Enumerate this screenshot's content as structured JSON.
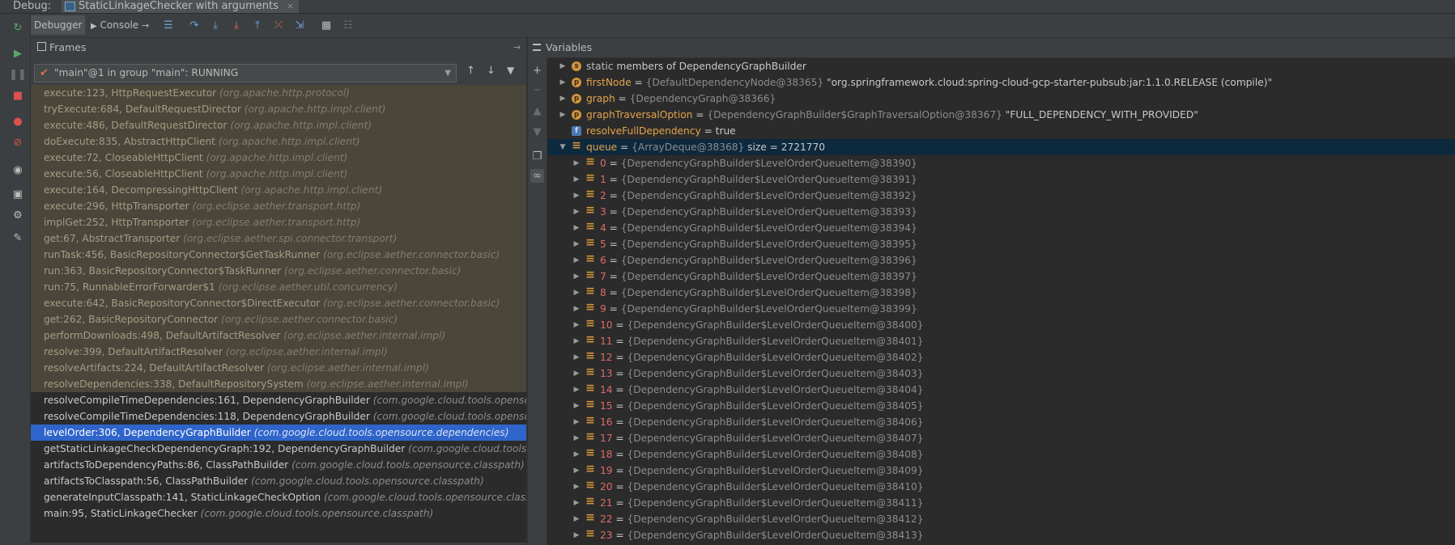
{
  "topbar": {
    "label": "Debug:",
    "tab_title": "StaticLinkageChecker with arguments",
    "close": "×"
  },
  "toolbar": {
    "debugger_tab": "Debugger",
    "console_tab": "Console",
    "console_arrow": "→"
  },
  "frames": {
    "title": "Frames",
    "pin": "→",
    "thread_selector": "\"main\"@1 in group \"main\": RUNNING",
    "items": [
      {
        "method": "execute:123, HttpRequestExecutor",
        "pkg": "(org.apache.http.protocol)",
        "kind": "lib"
      },
      {
        "method": "tryExecute:684, DefaultRequestDirector",
        "pkg": "(org.apache.http.impl.client)",
        "kind": "lib"
      },
      {
        "method": "execute:486, DefaultRequestDirector",
        "pkg": "(org.apache.http.impl.client)",
        "kind": "lib"
      },
      {
        "method": "doExecute:835, AbstractHttpClient",
        "pkg": "(org.apache.http.impl.client)",
        "kind": "lib"
      },
      {
        "method": "execute:72, CloseableHttpClient",
        "pkg": "(org.apache.http.impl.client)",
        "kind": "lib"
      },
      {
        "method": "execute:56, CloseableHttpClient",
        "pkg": "(org.apache.http.impl.client)",
        "kind": "lib"
      },
      {
        "method": "execute:164, DecompressingHttpClient",
        "pkg": "(org.apache.http.impl.client)",
        "kind": "lib"
      },
      {
        "method": "execute:296, HttpTransporter",
        "pkg": "(org.eclipse.aether.transport.http)",
        "kind": "lib"
      },
      {
        "method": "implGet:252, HttpTransporter",
        "pkg": "(org.eclipse.aether.transport.http)",
        "kind": "lib"
      },
      {
        "method": "get:67, AbstractTransporter",
        "pkg": "(org.eclipse.aether.spi.connector.transport)",
        "kind": "lib"
      },
      {
        "method": "runTask:456, BasicRepositoryConnector$GetTaskRunner",
        "pkg": "(org.eclipse.aether.connector.basic)",
        "kind": "lib"
      },
      {
        "method": "run:363, BasicRepositoryConnector$TaskRunner",
        "pkg": "(org.eclipse.aether.connector.basic)",
        "kind": "lib"
      },
      {
        "method": "run:75, RunnableErrorForwarder$1",
        "pkg": "(org.eclipse.aether.util.concurrency)",
        "kind": "lib"
      },
      {
        "method": "execute:642, BasicRepositoryConnector$DirectExecutor",
        "pkg": "(org.eclipse.aether.connector.basic)",
        "kind": "lib"
      },
      {
        "method": "get:262, BasicRepositoryConnector",
        "pkg": "(org.eclipse.aether.connector.basic)",
        "kind": "lib"
      },
      {
        "method": "performDownloads:498, DefaultArtifactResolver",
        "pkg": "(org.eclipse.aether.internal.impl)",
        "kind": "lib"
      },
      {
        "method": "resolve:399, DefaultArtifactResolver",
        "pkg": "(org.eclipse.aether.internal.impl)",
        "kind": "lib"
      },
      {
        "method": "resolveArtifacts:224, DefaultArtifactResolver",
        "pkg": "(org.eclipse.aether.internal.impl)",
        "kind": "lib"
      },
      {
        "method": "resolveDependencies:338, DefaultRepositorySystem",
        "pkg": "(org.eclipse.aether.internal.impl)",
        "kind": "lib"
      },
      {
        "method": "resolveCompileTimeDependencies:161, DependencyGraphBuilder",
        "pkg": "(com.google.cloud.tools.opensou",
        "kind": "app"
      },
      {
        "method": "resolveCompileTimeDependencies:118, DependencyGraphBuilder",
        "pkg": "(com.google.cloud.tools.opensou",
        "kind": "app"
      },
      {
        "method": "levelOrder:306, DependencyGraphBuilder",
        "pkg": "(com.google.cloud.tools.opensource.dependencies)",
        "kind": "sel"
      },
      {
        "method": "getStaticLinkageCheckDependencyGraph:192, DependencyGraphBuilder",
        "pkg": "(com.google.cloud.tools.",
        "kind": "app"
      },
      {
        "method": "artifactsToDependencyPaths:86, ClassPathBuilder",
        "pkg": "(com.google.cloud.tools.opensource.classpath)",
        "kind": "app"
      },
      {
        "method": "artifactsToClasspath:56, ClassPathBuilder",
        "pkg": "(com.google.cloud.tools.opensource.classpath)",
        "kind": "app"
      },
      {
        "method": "generateInputClasspath:141, StaticLinkageCheckOption",
        "pkg": "(com.google.cloud.tools.opensource.class",
        "kind": "app"
      },
      {
        "method": "main:95, StaticLinkageChecker",
        "pkg": "(com.google.cloud.tools.opensource.classpath)",
        "kind": "app"
      }
    ]
  },
  "variables": {
    "title": "Variables",
    "top_items": [
      {
        "badge": "s",
        "name": "static",
        "rest": " members of DependencyGraphBuilder",
        "plain": true,
        "expandable": true
      },
      {
        "badge": "p",
        "name": "firstNode",
        "eq": " = ",
        "type": "{DefaultDependencyNode@38365}",
        "val": " \"org.springframework.cloud:spring-cloud-gcp-starter-pubsub:jar:1.1.0.RELEASE (compile)\"",
        "expandable": true
      },
      {
        "badge": "p",
        "name": "graph",
        "eq": " = ",
        "type": "{DependencyGraph@38366}",
        "val": "",
        "expandable": true
      },
      {
        "badge": "p",
        "name": "graphTraversalOption",
        "eq": " = ",
        "type": "{DependencyGraphBuilder$GraphTraversalOption@38367}",
        "val": " \"FULL_DEPENDENCY_WITH_PROVIDED\"",
        "expandable": true
      },
      {
        "badge": "f",
        "name": "resolveFullDependency",
        "eq": " = ",
        "type": "",
        "val": "true",
        "expandable": false
      },
      {
        "badge": "arr",
        "name": "queue",
        "eq": " = ",
        "type": "{ArrayDeque@38368}",
        "val": "  size = 2721770",
        "expandable": true,
        "expanded": true,
        "selected": true
      }
    ],
    "queue_items": [
      {
        "idx": "0",
        "type": "{DependencyGraphBuilder$LevelOrderQueueItem@38390}"
      },
      {
        "idx": "1",
        "type": "{DependencyGraphBuilder$LevelOrderQueueItem@38391}"
      },
      {
        "idx": "2",
        "type": "{DependencyGraphBuilder$LevelOrderQueueItem@38392}"
      },
      {
        "idx": "3",
        "type": "{DependencyGraphBuilder$LevelOrderQueueItem@38393}"
      },
      {
        "idx": "4",
        "type": "{DependencyGraphBuilder$LevelOrderQueueItem@38394}"
      },
      {
        "idx": "5",
        "type": "{DependencyGraphBuilder$LevelOrderQueueItem@38395}"
      },
      {
        "idx": "6",
        "type": "{DependencyGraphBuilder$LevelOrderQueueItem@38396}"
      },
      {
        "idx": "7",
        "type": "{DependencyGraphBuilder$LevelOrderQueueItem@38397}"
      },
      {
        "idx": "8",
        "type": "{DependencyGraphBuilder$LevelOrderQueueItem@38398}"
      },
      {
        "idx": "9",
        "type": "{DependencyGraphBuilder$LevelOrderQueueItem@38399}"
      },
      {
        "idx": "10",
        "type": "{DependencyGraphBuilder$LevelOrderQueueItem@38400}"
      },
      {
        "idx": "11",
        "type": "{DependencyGraphBuilder$LevelOrderQueueItem@38401}"
      },
      {
        "idx": "12",
        "type": "{DependencyGraphBuilder$LevelOrderQueueItem@38402}"
      },
      {
        "idx": "13",
        "type": "{DependencyGraphBuilder$LevelOrderQueueItem@38403}"
      },
      {
        "idx": "14",
        "type": "{DependencyGraphBuilder$LevelOrderQueueItem@38404}"
      },
      {
        "idx": "15",
        "type": "{DependencyGraphBuilder$LevelOrderQueueItem@38405}"
      },
      {
        "idx": "16",
        "type": "{DependencyGraphBuilder$LevelOrderQueueItem@38406}"
      },
      {
        "idx": "17",
        "type": "{DependencyGraphBuilder$LevelOrderQueueItem@38407}"
      },
      {
        "idx": "18",
        "type": "{DependencyGraphBuilder$LevelOrderQueueItem@38408}"
      },
      {
        "idx": "19",
        "type": "{DependencyGraphBuilder$LevelOrderQueueItem@38409}"
      },
      {
        "idx": "20",
        "type": "{DependencyGraphBuilder$LevelOrderQueueItem@38410}"
      },
      {
        "idx": "21",
        "type": "{DependencyGraphBuilder$LevelOrderQueueItem@38411}"
      },
      {
        "idx": "22",
        "type": "{DependencyGraphBuilder$LevelOrderQueueItem@38412}"
      },
      {
        "idx": "23",
        "type": "{DependencyGraphBuilder$LevelOrderQueueItem@38413}"
      }
    ]
  },
  "colors": {
    "accent_selection": "#2f65ca",
    "library_frame_bg": "#4a463a",
    "variable_name": "#e4a44a",
    "index": "#e06a6a"
  }
}
